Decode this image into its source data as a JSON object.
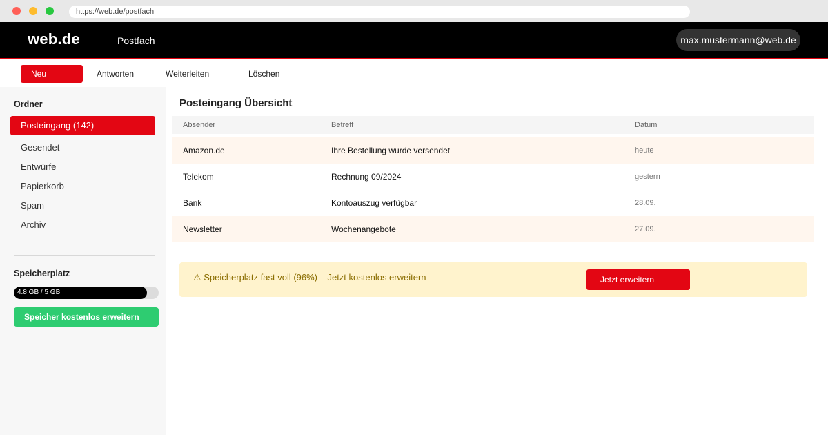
{
  "browser": {
    "url": "https://web.de/postfach"
  },
  "header": {
    "logo": "web.de",
    "section": "Postfach",
    "account": "max.mustermann@web.de"
  },
  "toolbar": {
    "new_label": "Neu",
    "reply_label": "Antworten",
    "forward_label": "Weiterleiten",
    "delete_label": "Löschen"
  },
  "sidebar": {
    "folders_heading": "Ordner",
    "folders": [
      {
        "label": "Posteingang (142)",
        "active": true
      },
      {
        "label": "Gesendet",
        "active": false
      },
      {
        "label": "Entwürfe",
        "active": false
      },
      {
        "label": "Papierkorb",
        "active": false
      },
      {
        "label": "Spam",
        "active": false
      },
      {
        "label": "Archiv",
        "active": false
      }
    ],
    "storage_heading": "Speicherplatz",
    "storage_text": "4.8 GB / 5 GB",
    "storage_fill_fraction": 0.92,
    "storage_button": "Speicher kostenlos erweitern"
  },
  "main": {
    "title": "Posteingang Übersicht",
    "columns": {
      "sender": "Absender",
      "subject": "Betreff",
      "date": "Datum"
    },
    "emails": [
      {
        "sender": "Amazon.de",
        "subject": "Ihre Bestellung wurde versendet",
        "date": "heute"
      },
      {
        "sender": "Telekom",
        "subject": "Rechnung 09/2024",
        "date": "gestern"
      },
      {
        "sender": "Bank",
        "subject": "Kontoauszug verfügbar",
        "date": "28.09."
      },
      {
        "sender": "Newsletter",
        "subject": "Wochenangebote",
        "date": "27.09."
      }
    ],
    "banner": {
      "text": "⚠ Speicherplatz fast voll (96%) – Jetzt kostenlos erweitern",
      "button": "Jetzt erweitern"
    }
  },
  "colors": {
    "brand_red": "#e30613",
    "header_black": "#000000",
    "storage_green": "#2ecc71",
    "banner_yellow": "#fff3cd"
  }
}
